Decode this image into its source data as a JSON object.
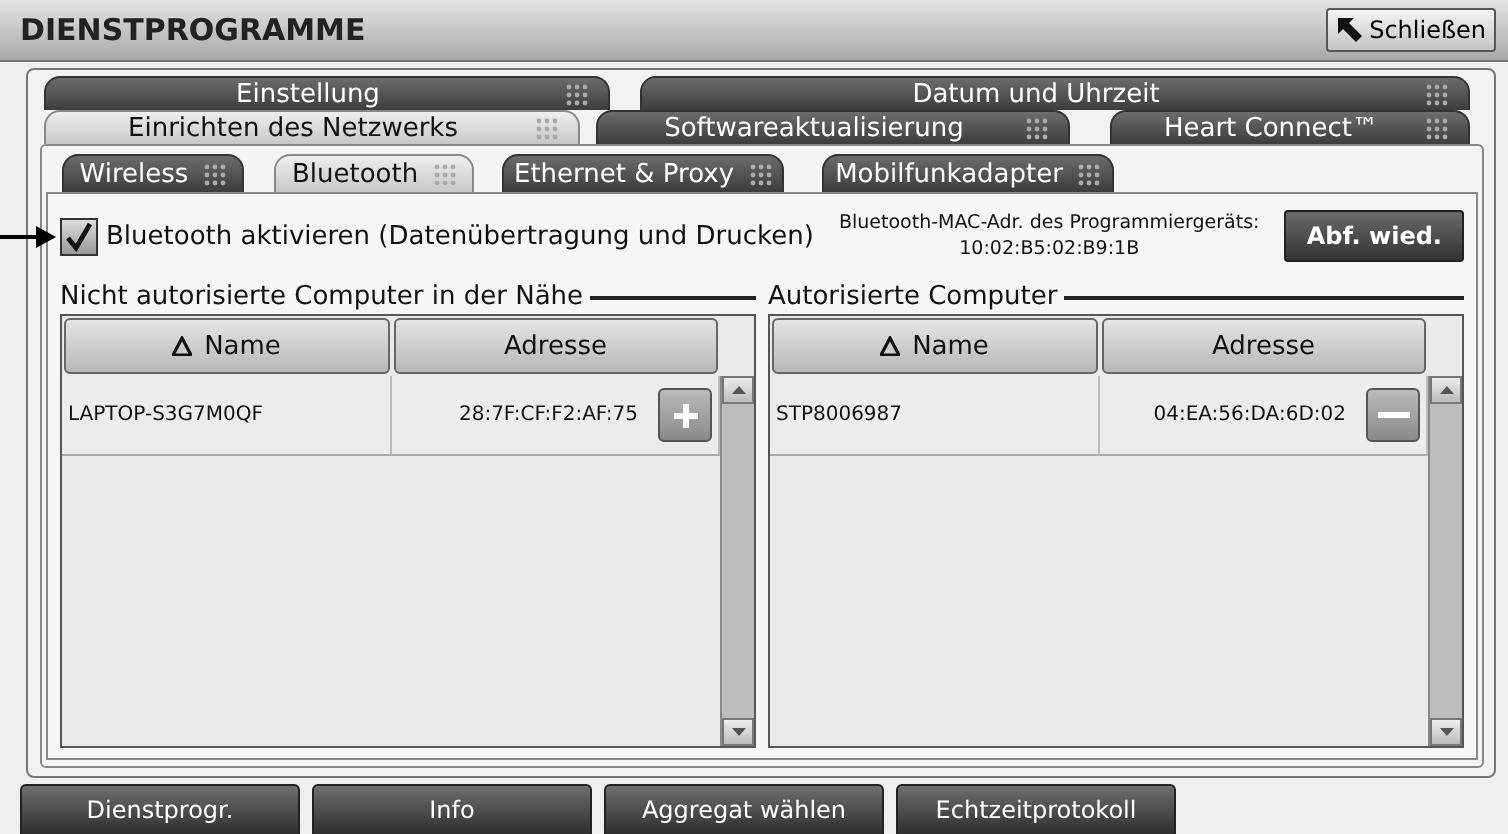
{
  "title": "DIENSTPROGRAMME",
  "close_button": "Schließen",
  "tabs_row1": [
    {
      "label": "Einstellung",
      "selected": false
    },
    {
      "label": "Datum und Uhrzeit",
      "selected": false
    }
  ],
  "tabs_row2": [
    {
      "label": "Einrichten des Netzwerks",
      "selected": true
    },
    {
      "label": "Softwareaktualisierung",
      "selected": false
    },
    {
      "label": "Heart Connect™",
      "selected": false
    }
  ],
  "subtabs": [
    {
      "label": "Wireless",
      "selected": false
    },
    {
      "label": "Bluetooth",
      "selected": true
    },
    {
      "label": "Ethernet & Proxy",
      "selected": false
    },
    {
      "label": "Mobilfunkadapter",
      "selected": false
    }
  ],
  "bluetooth": {
    "label": "Bluetooth aktivieren (Datenübertragung und Drucken)",
    "checked": true
  },
  "mac_label": "Bluetooth-MAC-Adr. des Programmiergeräts:",
  "mac_address": "10:02:B5:02:B9:1B",
  "refresh_button": "Abf. wied.",
  "groups": [
    {
      "title": "Nicht autorisierte Computer in der Nähe",
      "columns": [
        {
          "label": "Name",
          "sorted": true
        },
        {
          "label": "Adresse",
          "sorted": false
        }
      ],
      "rows": [
        {
          "name": "LAPTOP-S3G7M0QF",
          "address": "28:7F:CF:F2:AF:75",
          "kind": "add"
        }
      ]
    },
    {
      "title": "Autorisierte Computer",
      "columns": [
        {
          "label": "Name",
          "sorted": true
        },
        {
          "label": "Adresse",
          "sorted": false
        }
      ],
      "rows": [
        {
          "name": "STP8006987",
          "address": "04:EA:56:DA:6D:02",
          "kind": "remove"
        }
      ]
    }
  ],
  "footer_buttons": [
    "Dienstprogr.",
    "Info",
    "Aggregat wählen",
    "Echtzeitprotokoll"
  ]
}
